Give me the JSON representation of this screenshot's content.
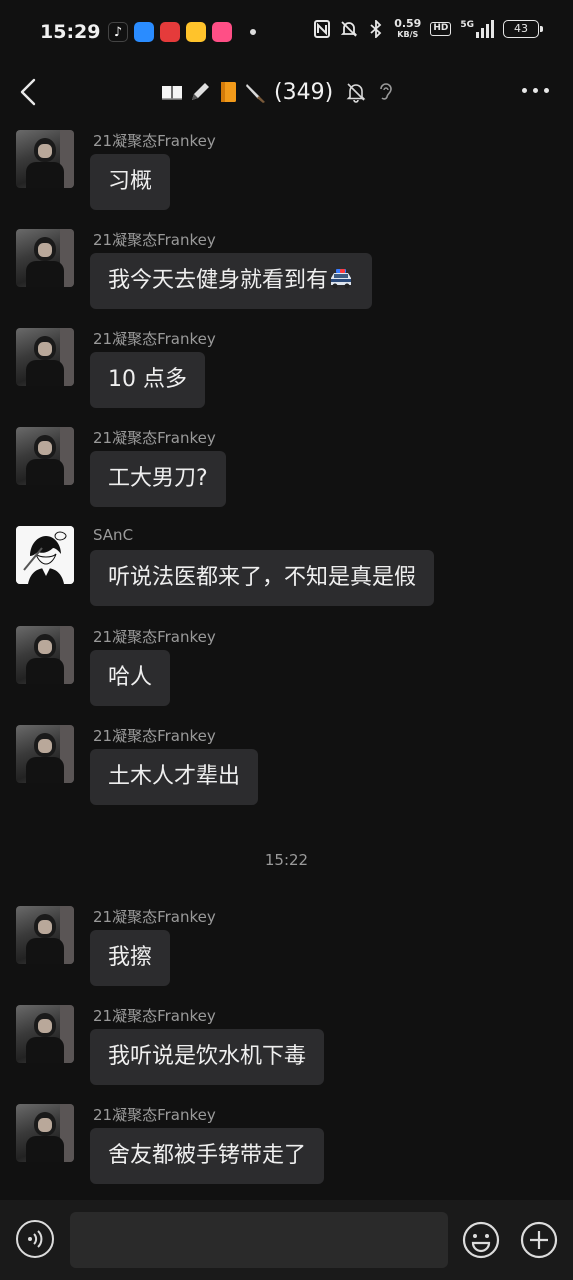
{
  "status_bar": {
    "time": "15:29",
    "net_speed_value": "0.59",
    "net_speed_unit": "KB/S",
    "hd": "HD",
    "signal_label": "5G",
    "battery": "43"
  },
  "header": {
    "title_count": "(349)"
  },
  "messages": [
    {
      "sender": "21凝聚态Frankey",
      "text": "习概",
      "avatar": "frankey"
    },
    {
      "sender": "21凝聚态Frankey",
      "text": "我今天去健身就看到有",
      "avatar": "frankey",
      "emoji": "police-car"
    },
    {
      "sender": "21凝聚态Frankey",
      "text": "10 点多",
      "avatar": "frankey"
    },
    {
      "sender": "21凝聚态Frankey",
      "text": "工大男刀?",
      "avatar": "frankey"
    },
    {
      "sender": "SAnC",
      "text": "听说法医都来了，不知是真是假",
      "avatar": "sanc"
    },
    {
      "sender": "21凝聚态Frankey",
      "text": "哈人",
      "avatar": "frankey"
    },
    {
      "sender": "21凝聚态Frankey",
      "text": "土木人才辈出",
      "avatar": "frankey"
    },
    {
      "sender": "21凝聚态Frankey",
      "text": "我擦",
      "avatar": "frankey"
    },
    {
      "sender": "21凝聚态Frankey",
      "text": "我听说是饮水机下毒",
      "avatar": "frankey"
    },
    {
      "sender": "21凝聚态Frankey",
      "text": "舍友都被手铐带走了",
      "avatar": "frankey"
    }
  ],
  "timestamp": "15:22",
  "input": {
    "placeholder": ""
  },
  "icons": {
    "back": "chevron-left-icon",
    "more": "more-dots-icon",
    "voice": "voice-icon",
    "emoji": "emoji-icon",
    "plus": "plus-icon"
  }
}
